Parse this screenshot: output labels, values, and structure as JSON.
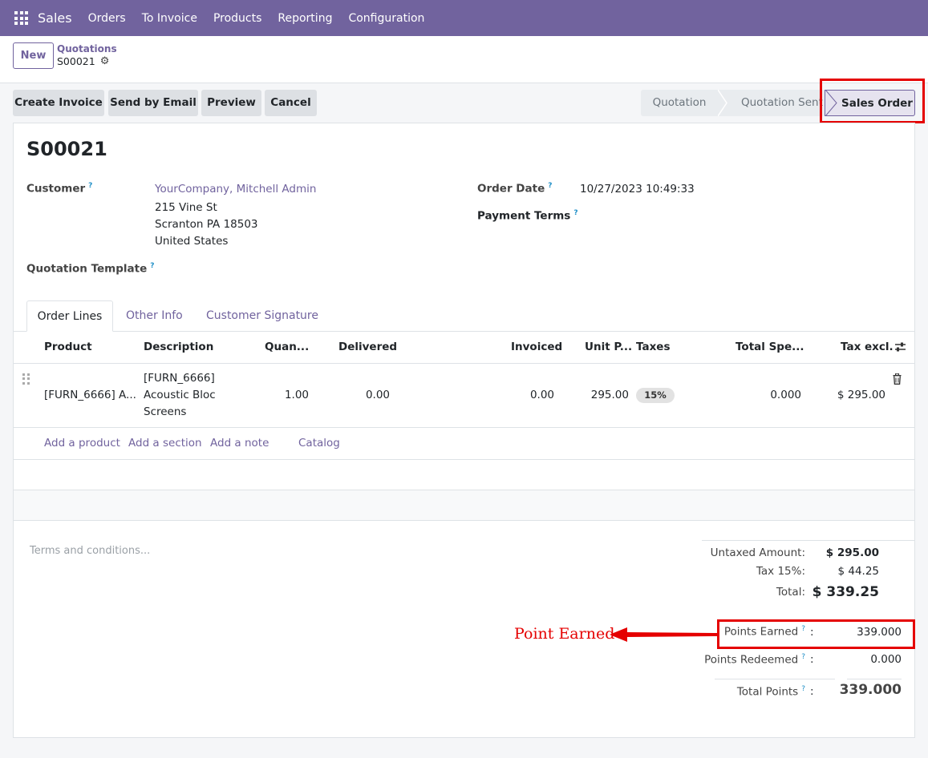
{
  "navbar": {
    "app_name": "Sales",
    "menu": [
      "Orders",
      "To Invoice",
      "Products",
      "Reporting",
      "Configuration"
    ]
  },
  "control_panel": {
    "new_label": "New",
    "breadcrumb_parent": "Quotations",
    "breadcrumb_current": "S00021"
  },
  "actions": [
    "Create Invoice",
    "Send by Email",
    "Preview",
    "Cancel"
  ],
  "status": {
    "stages": [
      "Quotation",
      "Quotation Sent"
    ],
    "active": "Sales Order"
  },
  "order": {
    "name": "S00021",
    "customer_label": "Customer",
    "customer_name": "YourCompany, Mitchell Admin",
    "address_line1": "215 Vine St",
    "address_line2": "Scranton PA 18503",
    "address_line3": "United States",
    "template_label": "Quotation Template",
    "order_date_label": "Order Date",
    "order_date": "10/27/2023 10:49:33",
    "payment_terms_label": "Payment Terms",
    "help_mark": "?"
  },
  "tabs": [
    "Order Lines",
    "Other Info",
    "Customer Signature"
  ],
  "lines": {
    "headers": [
      "Product",
      "Description",
      "Quan...",
      "Delivered",
      "Invoiced",
      "Unit P...",
      "Taxes",
      "Total Spe...",
      "Tax excl."
    ],
    "rows": [
      {
        "product": "[FURN_6666] A...",
        "desc1": "[FURN_6666]",
        "desc2": "Acoustic Bloc",
        "desc3": "Screens",
        "quantity": "1.00",
        "delivered": "0.00",
        "invoiced": "0.00",
        "unit_price": "295.00",
        "tax": "15%",
        "total_spent": "0.000",
        "tax_excl": "$ 295.00"
      }
    ],
    "add_links": [
      "Add a product",
      "Add a section",
      "Add a note",
      "Catalog"
    ]
  },
  "terms_placeholder": "Terms and conditions...",
  "totals": {
    "untaxed_label": "Untaxed Amount:",
    "untaxed": "$ 295.00",
    "tax_label": "Tax 15%:",
    "tax": "$ 44.25",
    "total_label": "Total:",
    "total": "$ 339.25"
  },
  "points": {
    "earned_label": "Points Earned",
    "earned": "339.000",
    "redeemed_label": "Points Redeemed",
    "redeemed": "0.000",
    "total_label": "Total Points",
    "total": "339.000",
    "colon": ":"
  },
  "annotation": "Point Earned",
  "colors": {
    "brand": "#71639e",
    "highlight": "#e50000"
  }
}
